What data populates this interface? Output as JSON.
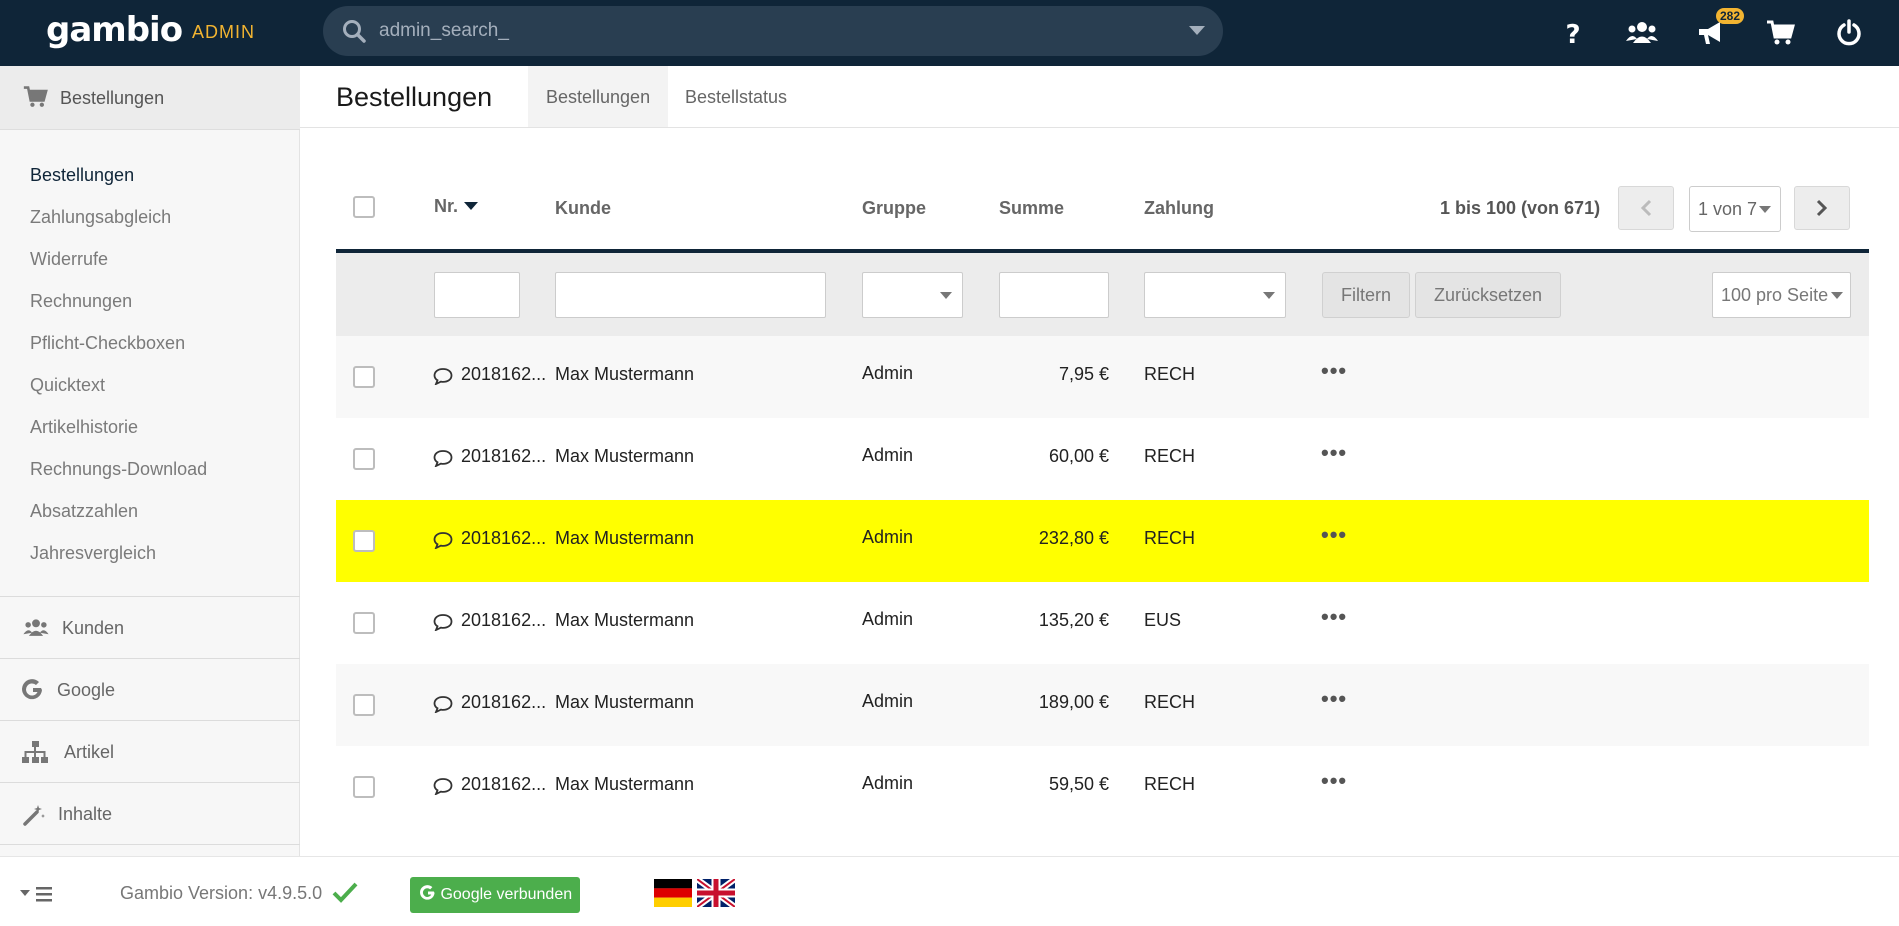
{
  "header": {
    "brand": "gambio",
    "brand_sub": "ADMIN",
    "search_placeholder": "admin_search_",
    "notification_count": "282"
  },
  "sidebar": {
    "active_section": "Bestellungen",
    "sub_items": [
      "Bestellungen",
      "Zahlungsabgleich",
      "Widerrufe",
      "Rechnungen",
      "Pflicht-Checkboxen",
      "Quicktext",
      "Artikelhistorie",
      "Rechnungs-Download",
      "Absatzzahlen",
      "Jahresvergleich"
    ],
    "sections": [
      "Kunden",
      "Google",
      "Artikel",
      "Inhalte"
    ]
  },
  "page": {
    "title": "Bestellungen",
    "tabs": [
      "Bestellungen",
      "Bestellstatus"
    ]
  },
  "table": {
    "columns": {
      "nr": "Nr.",
      "kunde": "Kunde",
      "gruppe": "Gruppe",
      "summe": "Summe",
      "zahlung": "Zahlung"
    },
    "pagination_info": "1 bis 100 (von 671)",
    "page_select": "1 von 7",
    "filter_label": "Filtern",
    "reset_label": "Zurücksetzen",
    "per_page": "100 pro Seite",
    "rows": [
      {
        "nr": "2018162...",
        "kunde": "Max Mustermann",
        "gruppe": "Admin",
        "summe": "7,95 €",
        "zahlung": "RECH",
        "highlight": false
      },
      {
        "nr": "2018162...",
        "kunde": "Max Mustermann",
        "gruppe": "Admin",
        "summe": "60,00 €",
        "zahlung": "RECH",
        "highlight": false
      },
      {
        "nr": "2018162...",
        "kunde": "Max Mustermann",
        "gruppe": "Admin",
        "summe": "232,80 €",
        "zahlung": "RECH",
        "highlight": true
      },
      {
        "nr": "2018162...",
        "kunde": "Max Mustermann",
        "gruppe": "Admin",
        "summe": "135,20 €",
        "zahlung": "EUS",
        "highlight": false
      },
      {
        "nr": "2018162...",
        "kunde": "Max Mustermann",
        "gruppe": "Admin",
        "summe": "189,00 €",
        "zahlung": "RECH",
        "highlight": false
      },
      {
        "nr": "2018162...",
        "kunde": "Max Mustermann",
        "gruppe": "Admin",
        "summe": "59,50 €",
        "zahlung": "RECH",
        "highlight": false
      }
    ],
    "row_actions": "•••"
  },
  "footer": {
    "version": "Gambio Version: v4.9.5.0",
    "google_button": "Google verbunden"
  },
  "colors": {
    "header_bg": "#0f2538",
    "accent": "#f2b431",
    "highlight_row": "#ffff00",
    "google_green": "#4cae4c"
  }
}
